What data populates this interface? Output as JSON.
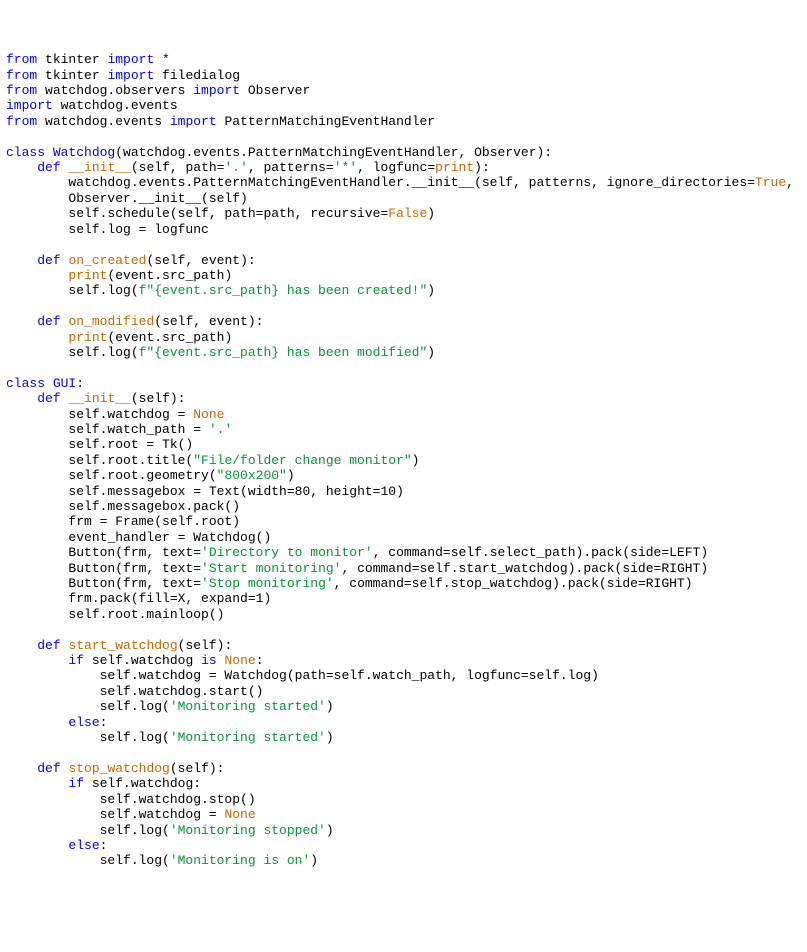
{
  "code": {
    "lines": [
      [
        {
          "cls": "kw-import",
          "t": "from"
        },
        {
          "cls": "plain",
          "t": " tkinter "
        },
        {
          "cls": "kw-import",
          "t": "import"
        },
        {
          "cls": "plain",
          "t": " *"
        }
      ],
      [
        {
          "cls": "kw-import",
          "t": "from"
        },
        {
          "cls": "plain",
          "t": " tkinter "
        },
        {
          "cls": "kw-import",
          "t": "import"
        },
        {
          "cls": "plain",
          "t": " filedialog"
        }
      ],
      [
        {
          "cls": "kw-import",
          "t": "from"
        },
        {
          "cls": "plain",
          "t": " watchdog.observers "
        },
        {
          "cls": "kw-import",
          "t": "import"
        },
        {
          "cls": "plain",
          "t": " Observer"
        }
      ],
      [
        {
          "cls": "kw-import",
          "t": "import"
        },
        {
          "cls": "plain",
          "t": " watchdog.events"
        }
      ],
      [
        {
          "cls": "kw-import",
          "t": "from"
        },
        {
          "cls": "plain",
          "t": " watchdog.events "
        },
        {
          "cls": "kw-import",
          "t": "import"
        },
        {
          "cls": "plain",
          "t": " PatternMatchingEventHandler"
        }
      ],
      [],
      [
        {
          "cls": "kw-class",
          "t": "class "
        },
        {
          "cls": "class-name",
          "t": "Watchdog"
        },
        {
          "cls": "plain",
          "t": "(watchdog.events.PatternMatchingEventHandler, Observer):"
        }
      ],
      [
        {
          "cls": "plain",
          "t": "    "
        },
        {
          "cls": "kw-def",
          "t": "def "
        },
        {
          "cls": "def-name",
          "t": "__init__"
        },
        {
          "cls": "plain",
          "t": "(self, path="
        },
        {
          "cls": "string",
          "t": "'.'"
        },
        {
          "cls": "plain",
          "t": ", patterns="
        },
        {
          "cls": "string",
          "t": "'*'"
        },
        {
          "cls": "plain",
          "t": ", logfunc="
        },
        {
          "cls": "kw-print",
          "t": "print"
        },
        {
          "cls": "plain",
          "t": "):"
        }
      ],
      [
        {
          "cls": "plain",
          "t": "        watchdog.events.PatternMatchingEventHandler.__init__(self, patterns, ignore_directories="
        },
        {
          "cls": "kw-bool",
          "t": "True"
        },
        {
          "cls": "plain",
          "t": ","
        }
      ],
      [
        {
          "cls": "plain",
          "t": "        Observer.__init__(self)"
        }
      ],
      [
        {
          "cls": "plain",
          "t": "        self.schedule(self, path=path, recursive="
        },
        {
          "cls": "kw-bool",
          "t": "False"
        },
        {
          "cls": "plain",
          "t": ")"
        }
      ],
      [
        {
          "cls": "plain",
          "t": "        self.log = logfunc"
        }
      ],
      [],
      [
        {
          "cls": "plain",
          "t": "    "
        },
        {
          "cls": "kw-def",
          "t": "def "
        },
        {
          "cls": "def-name",
          "t": "on_created"
        },
        {
          "cls": "plain",
          "t": "(self, event):"
        }
      ],
      [
        {
          "cls": "plain",
          "t": "        "
        },
        {
          "cls": "kw-print",
          "t": "print"
        },
        {
          "cls": "plain",
          "t": "(event.src_path)"
        }
      ],
      [
        {
          "cls": "plain",
          "t": "        self.log("
        },
        {
          "cls": "string",
          "t": "f\"{event.src_path} has been created!\""
        },
        {
          "cls": "plain",
          "t": ")"
        }
      ],
      [],
      [
        {
          "cls": "plain",
          "t": "    "
        },
        {
          "cls": "kw-def",
          "t": "def "
        },
        {
          "cls": "def-name",
          "t": "on_modified"
        },
        {
          "cls": "plain",
          "t": "(self, event):"
        }
      ],
      [
        {
          "cls": "plain",
          "t": "        "
        },
        {
          "cls": "kw-print",
          "t": "print"
        },
        {
          "cls": "plain",
          "t": "(event.src_path)"
        }
      ],
      [
        {
          "cls": "plain",
          "t": "        self.log("
        },
        {
          "cls": "string",
          "t": "f\"{event.src_path} has been modified\""
        },
        {
          "cls": "plain",
          "t": ")"
        }
      ],
      [],
      [
        {
          "cls": "kw-class",
          "t": "class "
        },
        {
          "cls": "class-name",
          "t": "GUI"
        },
        {
          "cls": "plain",
          "t": ":"
        }
      ],
      [
        {
          "cls": "plain",
          "t": "    "
        },
        {
          "cls": "kw-def",
          "t": "def "
        },
        {
          "cls": "def-name",
          "t": "__init__"
        },
        {
          "cls": "plain",
          "t": "(self):"
        }
      ],
      [
        {
          "cls": "plain",
          "t": "        self.watchdog = "
        },
        {
          "cls": "kw-none",
          "t": "None"
        }
      ],
      [
        {
          "cls": "plain",
          "t": "        self.watch_path = "
        },
        {
          "cls": "string",
          "t": "'.'"
        }
      ],
      [
        {
          "cls": "plain",
          "t": "        self.root = Tk()"
        }
      ],
      [
        {
          "cls": "plain",
          "t": "        self.root.title("
        },
        {
          "cls": "string",
          "t": "\"File/folder change monitor\""
        },
        {
          "cls": "plain",
          "t": ")"
        }
      ],
      [
        {
          "cls": "plain",
          "t": "        self.root.geometry("
        },
        {
          "cls": "string",
          "t": "\"800x200\""
        },
        {
          "cls": "plain",
          "t": ")"
        }
      ],
      [
        {
          "cls": "plain",
          "t": "        self.messagebox = Text(width="
        },
        {
          "cls": "plain",
          "t": "80"
        },
        {
          "cls": "plain",
          "t": ", height="
        },
        {
          "cls": "plain",
          "t": "10"
        },
        {
          "cls": "plain",
          "t": ")"
        }
      ],
      [
        {
          "cls": "plain",
          "t": "        self.messagebox.pack()"
        }
      ],
      [
        {
          "cls": "plain",
          "t": "        frm = Frame(self.root)"
        }
      ],
      [
        {
          "cls": "plain",
          "t": "        event_handler = Watchdog()"
        }
      ],
      [
        {
          "cls": "plain",
          "t": "        Button(frm, text="
        },
        {
          "cls": "string",
          "t": "'Directory to monitor'"
        },
        {
          "cls": "plain",
          "t": ", command=self.select_path).pack(side=LEFT)"
        }
      ],
      [
        {
          "cls": "plain",
          "t": "        Button(frm, text="
        },
        {
          "cls": "string",
          "t": "'Start monitoring'"
        },
        {
          "cls": "plain",
          "t": ", command=self.start_watchdog).pack(side=RIGHT)"
        }
      ],
      [
        {
          "cls": "plain",
          "t": "        Button(frm, text="
        },
        {
          "cls": "string",
          "t": "'Stop monitoring'"
        },
        {
          "cls": "plain",
          "t": ", command=self.stop_watchdog).pack(side=RIGHT)"
        }
      ],
      [
        {
          "cls": "plain",
          "t": "        frm.pack(fill=X, expand="
        },
        {
          "cls": "plain",
          "t": "1"
        },
        {
          "cls": "plain",
          "t": ")"
        }
      ],
      [
        {
          "cls": "plain",
          "t": "        self.root.mainloop()"
        }
      ],
      [],
      [
        {
          "cls": "plain",
          "t": "    "
        },
        {
          "cls": "kw-def",
          "t": "def "
        },
        {
          "cls": "def-name",
          "t": "start_watchdog"
        },
        {
          "cls": "plain",
          "t": "(self):"
        }
      ],
      [
        {
          "cls": "plain",
          "t": "        "
        },
        {
          "cls": "kw-ctrl",
          "t": "if"
        },
        {
          "cls": "plain",
          "t": " self.watchdog "
        },
        {
          "cls": "kw-ctrl",
          "t": "is"
        },
        {
          "cls": "plain",
          "t": " "
        },
        {
          "cls": "kw-none",
          "t": "None"
        },
        {
          "cls": "plain",
          "t": ":"
        }
      ],
      [
        {
          "cls": "plain",
          "t": "            self.watchdog = Watchdog(path=self.watch_path, logfunc=self.log)"
        }
      ],
      [
        {
          "cls": "plain",
          "t": "            self.watchdog.start()"
        }
      ],
      [
        {
          "cls": "plain",
          "t": "            self.log("
        },
        {
          "cls": "string",
          "t": "'Monitoring started'"
        },
        {
          "cls": "plain",
          "t": ")"
        }
      ],
      [
        {
          "cls": "plain",
          "t": "        "
        },
        {
          "cls": "kw-ctrl",
          "t": "else"
        },
        {
          "cls": "plain",
          "t": ":"
        }
      ],
      [
        {
          "cls": "plain",
          "t": "            self.log("
        },
        {
          "cls": "string",
          "t": "'Monitoring started'"
        },
        {
          "cls": "plain",
          "t": ")"
        }
      ],
      [],
      [
        {
          "cls": "plain",
          "t": "    "
        },
        {
          "cls": "kw-def",
          "t": "def "
        },
        {
          "cls": "def-name",
          "t": "stop_watchdog"
        },
        {
          "cls": "plain",
          "t": "(self):"
        }
      ],
      [
        {
          "cls": "plain",
          "t": "        "
        },
        {
          "cls": "kw-ctrl",
          "t": "if"
        },
        {
          "cls": "plain",
          "t": " self.watchdog:"
        }
      ],
      [
        {
          "cls": "plain",
          "t": "            self.watchdog.stop()"
        }
      ],
      [
        {
          "cls": "plain",
          "t": "            self.watchdog = "
        },
        {
          "cls": "kw-none",
          "t": "None"
        }
      ],
      [
        {
          "cls": "plain",
          "t": "            self.log("
        },
        {
          "cls": "string",
          "t": "'Monitoring stopped'"
        },
        {
          "cls": "plain",
          "t": ")"
        }
      ],
      [
        {
          "cls": "plain",
          "t": "        "
        },
        {
          "cls": "kw-ctrl",
          "t": "else"
        },
        {
          "cls": "plain",
          "t": ":"
        }
      ],
      [
        {
          "cls": "plain",
          "t": "            self.log("
        },
        {
          "cls": "string",
          "t": "'Monitoring is on'"
        },
        {
          "cls": "plain",
          "t": ")"
        }
      ]
    ]
  }
}
